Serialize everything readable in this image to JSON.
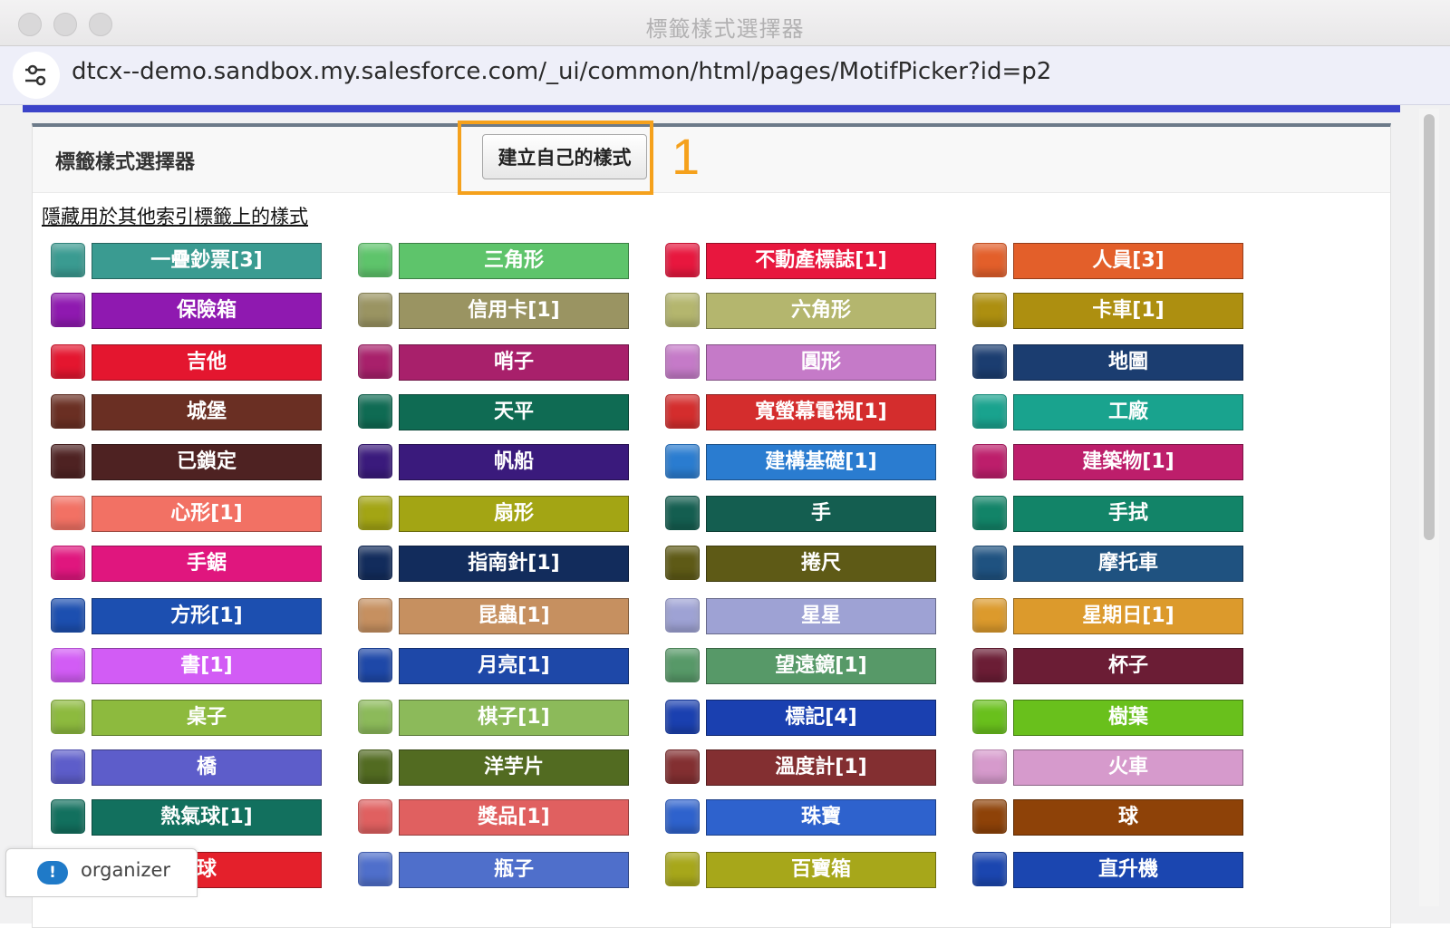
{
  "window": {
    "title": "標籤樣式選擇器"
  },
  "address_bar": {
    "url": "dtcx--demo.sandbox.my.salesforce.com/_ui/common/html/pages/MotifPicker?id=p2"
  },
  "panel": {
    "title": "標籤樣式選擇器",
    "create_button": "建立自己的樣式",
    "annotation_number": "1",
    "hide_link": "隱藏用於其他索引標籤上的樣式"
  },
  "motifs": [
    [
      {
        "label": "一疊鈔票[3]",
        "color": "#3a9b91",
        "icon": "money-stack-icon"
      },
      {
        "label": "保險箱",
        "color": "#8f19b0",
        "icon": "safe-icon"
      },
      {
        "label": "吉他",
        "color": "#e4162f",
        "icon": "guitar-icon"
      },
      {
        "label": "城堡",
        "color": "#6a2f23",
        "icon": "castle-icon"
      },
      {
        "label": "已鎖定",
        "color": "#4e2222",
        "icon": "lock-icon"
      },
      {
        "label": "心形[1]",
        "color": "#f27164",
        "icon": "heart-icon"
      },
      {
        "label": "手鋸",
        "color": "#e0167e",
        "icon": "handsaw-icon"
      },
      {
        "label": "方形[1]",
        "color": "#1c4fb0",
        "icon": "square-icon"
      },
      {
        "label": "書[1]",
        "color": "#d25cf5",
        "icon": "books-icon"
      },
      {
        "label": "桌子",
        "color": "#8dba3e",
        "icon": "desk-icon"
      },
      {
        "label": "橋",
        "color": "#5d5dca",
        "icon": "bridge-icon"
      },
      {
        "label": "熱氣球[1]",
        "color": "#12705e",
        "icon": "hot-air-balloon-icon"
      },
      {
        "label": "球",
        "color": "#e4202b",
        "icon": "ball-icon"
      }
    ],
    [
      {
        "label": "三角形",
        "color": "#5ec46b",
        "icon": "triangle-icon"
      },
      {
        "label": "信用卡[1]",
        "color": "#9a9462",
        "icon": "credit-card-icon"
      },
      {
        "label": "哨子",
        "color": "#a8206b",
        "icon": "whistle-icon"
      },
      {
        "label": "天平",
        "color": "#0f6b53",
        "icon": "scales-icon"
      },
      {
        "label": "帆船",
        "color": "#3a1a7c",
        "icon": "sailboat-icon"
      },
      {
        "label": "扇形",
        "color": "#a3a514",
        "icon": "fan-icon"
      },
      {
        "label": "指南針[1]",
        "color": "#122c5c",
        "icon": "compass-icon"
      },
      {
        "label": "昆蟲[1]",
        "color": "#c69060",
        "icon": "insect-icon"
      },
      {
        "label": "月亮[1]",
        "color": "#1e48a8",
        "icon": "moon-icon"
      },
      {
        "label": "棋子[1]",
        "color": "#8cba5a",
        "icon": "chess-piece-icon"
      },
      {
        "label": "洋芋片",
        "color": "#526b21",
        "icon": "chips-icon"
      },
      {
        "label": "獎品[1]",
        "color": "#e06060",
        "icon": "trophy-icon"
      },
      {
        "label": "瓶子",
        "color": "#4f6fcb",
        "icon": "bottle-icon"
      }
    ],
    [
      {
        "label": "不動產標誌[1]",
        "color": "#e8173e",
        "icon": "real-estate-sign-icon"
      },
      {
        "label": "六角形",
        "color": "#b4b66e",
        "icon": "hexagon-icon"
      },
      {
        "label": "圓形",
        "color": "#c57ac8",
        "icon": "circle-icon"
      },
      {
        "label": "寬螢幕電視[1]",
        "color": "#d42d2d",
        "icon": "widescreen-tv-icon"
      },
      {
        "label": "建構基礎[1]",
        "color": "#2a7cd0",
        "icon": "building-block-icon"
      },
      {
        "label": "手",
        "color": "#145e50",
        "icon": "hand-icon"
      },
      {
        "label": "捲尺",
        "color": "#5e5a16",
        "icon": "tape-measure-icon"
      },
      {
        "label": "星星",
        "color": "#9ea2d4",
        "icon": "star-icon"
      },
      {
        "label": "望遠鏡[1]",
        "color": "#579968",
        "icon": "telescope-icon"
      },
      {
        "label": "標記[4]",
        "color": "#1a40b0",
        "icon": "flag-icon"
      },
      {
        "label": "溫度計[1]",
        "color": "#832f31",
        "icon": "thermometer-icon"
      },
      {
        "label": "珠寶",
        "color": "#2e62cd",
        "icon": "jewel-icon"
      },
      {
        "label": "百寶箱",
        "color": "#a7a71a",
        "icon": "treasure-chest-icon"
      }
    ],
    [
      {
        "label": "人員[3]",
        "color": "#e35f2a",
        "icon": "people-icon"
      },
      {
        "label": "卡車[1]",
        "color": "#ad8f10",
        "icon": "truck-icon"
      },
      {
        "label": "地圖",
        "color": "#1b3d70",
        "icon": "map-icon"
      },
      {
        "label": "工廠",
        "color": "#19a38e",
        "icon": "factory-icon"
      },
      {
        "label": "建築物[1]",
        "color": "#bd1e6b",
        "icon": "buildings-icon"
      },
      {
        "label": "手拭",
        "color": "#128468",
        "icon": "hand-wave-icon"
      },
      {
        "label": "摩托車",
        "color": "#1f5280",
        "icon": "motorcycle-icon"
      },
      {
        "label": "星期日[1]",
        "color": "#dc9a2c",
        "icon": "sun-icon"
      },
      {
        "label": "杯子",
        "color": "#6b1d35",
        "icon": "cup-icon"
      },
      {
        "label": "樹葉",
        "color": "#69c01c",
        "icon": "leaf-icon"
      },
      {
        "label": "火車",
        "color": "#d69acc",
        "icon": "train-icon"
      },
      {
        "label": "球",
        "color": "#8e4208",
        "icon": "ball-icon"
      },
      {
        "label": "直升機",
        "color": "#1b46b0",
        "icon": "helicopter-icon"
      }
    ]
  ],
  "organizer": {
    "label": "organizer"
  }
}
